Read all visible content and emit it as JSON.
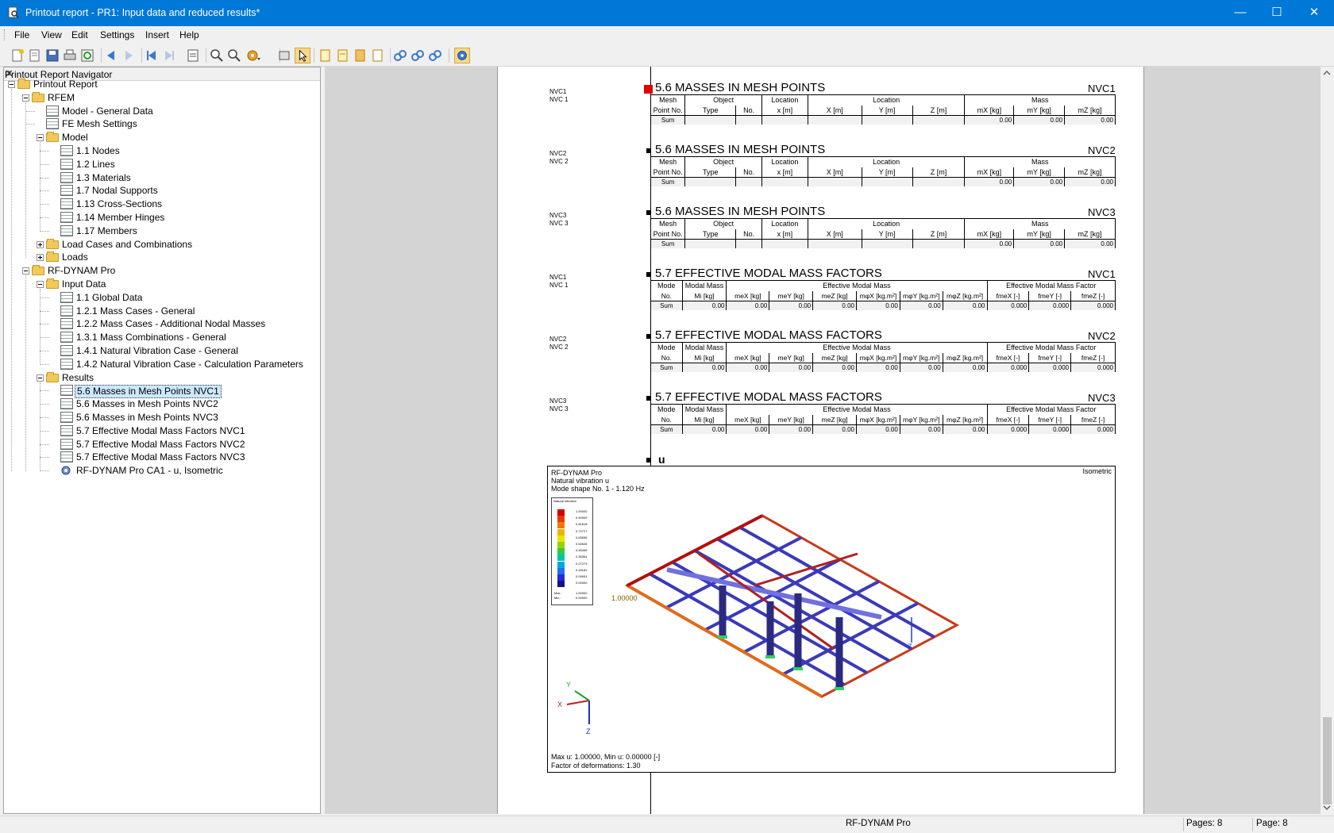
{
  "window": {
    "title": "Printout report - PR1: Input data and reduced results*",
    "minimize": "—",
    "maximize": "☐",
    "close": "✕"
  },
  "menu": [
    "File",
    "View",
    "Edit",
    "Settings",
    "Insert",
    "Help"
  ],
  "navigator": {
    "title": "Printout Report Navigator",
    "close": "✕",
    "items": [
      {
        "label": "Printout Report",
        "level": 0,
        "icon": "folder-icon",
        "exp": "minus"
      },
      {
        "label": "RFEM",
        "level": 1,
        "icon": "folder-icon",
        "exp": "minus"
      },
      {
        "label": "Model - General Data",
        "level": 2,
        "icon": "table-icon",
        "exp": ""
      },
      {
        "label": "FE Mesh Settings",
        "level": 2,
        "icon": "table-icon",
        "exp": ""
      },
      {
        "label": "Model",
        "level": 2,
        "icon": "folder-icon",
        "exp": "minus"
      },
      {
        "label": "1.1 Nodes",
        "level": 3,
        "icon": "table-icon",
        "exp": ""
      },
      {
        "label": "1.2 Lines",
        "level": 3,
        "icon": "table-icon",
        "exp": ""
      },
      {
        "label": "1.3 Materials",
        "level": 3,
        "icon": "table-icon",
        "exp": ""
      },
      {
        "label": "1.7 Nodal Supports",
        "level": 3,
        "icon": "table-icon",
        "exp": ""
      },
      {
        "label": "1.13 Cross-Sections",
        "level": 3,
        "icon": "table-icon",
        "exp": ""
      },
      {
        "label": "1.14 Member Hinges",
        "level": 3,
        "icon": "table-icon",
        "exp": ""
      },
      {
        "label": "1.17 Members",
        "level": 3,
        "icon": "table-icon",
        "exp": ""
      },
      {
        "label": "Load Cases and Combinations",
        "level": 2,
        "icon": "folder-icon",
        "exp": "plus"
      },
      {
        "label": "Loads",
        "level": 2,
        "icon": "folder-icon",
        "exp": "plus"
      },
      {
        "label": "RF-DYNAM Pro",
        "level": 1,
        "icon": "folder-icon",
        "exp": "minus"
      },
      {
        "label": "Input Data",
        "level": 2,
        "icon": "folder-icon",
        "exp": "minus"
      },
      {
        "label": "1.1 Global Data",
        "level": 3,
        "icon": "table-icon",
        "exp": ""
      },
      {
        "label": "1.2.1 Mass Cases - General",
        "level": 3,
        "icon": "table-icon",
        "exp": ""
      },
      {
        "label": "1.2.2 Mass Cases - Additional Nodal Masses",
        "level": 3,
        "icon": "table-icon",
        "exp": ""
      },
      {
        "label": "1.3.1 Mass Combinations - General",
        "level": 3,
        "icon": "table-icon",
        "exp": ""
      },
      {
        "label": "1.4.1 Natural Vibration Case - General",
        "level": 3,
        "icon": "table-icon",
        "exp": ""
      },
      {
        "label": "1.4.2 Natural Vibration Case - Calculation Parameters",
        "level": 3,
        "icon": "table-icon",
        "exp": ""
      },
      {
        "label": "Results",
        "level": 2,
        "icon": "folder-icon",
        "exp": "minus"
      },
      {
        "label": "5.6 Masses in Mesh Points NVC1",
        "level": 3,
        "icon": "table-icon",
        "exp": "",
        "selected": true
      },
      {
        "label": "5.6 Masses in Mesh Points NVC2",
        "level": 3,
        "icon": "table-icon",
        "exp": ""
      },
      {
        "label": "5.6 Masses in Mesh Points NVC3",
        "level": 3,
        "icon": "table-icon",
        "exp": ""
      },
      {
        "label": "5.7 Effective Modal Mass Factors NVC1",
        "level": 3,
        "icon": "table-icon",
        "exp": ""
      },
      {
        "label": "5.7 Effective Modal Mass Factors NVC2",
        "level": 3,
        "icon": "table-icon",
        "exp": ""
      },
      {
        "label": "5.7 Effective Modal Mass Factors NVC3",
        "level": 3,
        "icon": "table-icon",
        "exp": ""
      },
      {
        "label": "RF-DYNAM Pro CA1 -  u, Isometric",
        "level": 3,
        "icon": "graphic-icon",
        "exp": ""
      }
    ]
  },
  "report": {
    "masses": [
      {
        "side1": "NVC1",
        "side2": "NVC 1",
        "title": "5.6 MASSES IN MESH POINTS",
        "nvc": "NVC1",
        "sum": [
          "0.00",
          "0.00",
          "0.00"
        ]
      },
      {
        "side1": "NVC2",
        "side2": "NVC 2",
        "title": "5.6 MASSES IN MESH POINTS",
        "nvc": "NVC2",
        "sum": [
          "0.00",
          "0.00",
          "0.00"
        ]
      },
      {
        "side1": "NVC3",
        "side2": "NVC 3",
        "title": "5.6 MASSES IN MESH POINTS",
        "nvc": "NVC3",
        "sum": [
          "0.00",
          "0.00",
          "0.00"
        ]
      }
    ],
    "masses_header": {
      "r1": [
        "Mesh",
        "Object",
        "",
        "Location",
        "Location",
        "",
        "",
        "Mass",
        "",
        ""
      ],
      "r2": [
        "Point No.",
        "Type",
        "No.",
        "x [m]",
        "X [m]",
        "Y [m]",
        "Z [m]",
        "mX [kg]",
        "mY [kg]",
        "mZ [kg]"
      ],
      "sum_label": "Sum"
    },
    "factors": [
      {
        "side1": "NVC1",
        "side2": "NVC 1",
        "title": "5.7 EFFECTIVE MODAL MASS FACTORS",
        "nvc": "NVC1"
      },
      {
        "side1": "NVC2",
        "side2": "NVC 2",
        "title": "5.7 EFFECTIVE MODAL MASS FACTORS",
        "nvc": "NVC2"
      },
      {
        "side1": "NVC3",
        "side2": "NVC 3",
        "title": "5.7 EFFECTIVE MODAL MASS FACTORS",
        "nvc": "NVC3"
      }
    ],
    "factors_header": {
      "r1": [
        "Mode",
        "Modal Mass",
        "Effective Modal Mass",
        "Effective Modal Mass Factor"
      ],
      "r2": [
        "No.",
        "Mi [kg]",
        "meX [kg]",
        "meY [kg]",
        "meZ [kg]",
        "mφX [kg.m²]",
        "mφY [kg.m²]",
        "mφZ [kg.m²]",
        "fmeX [-]",
        "fmeY [-]",
        "fmeZ [-]"
      ],
      "sum": [
        "Sum",
        "0.00",
        "0.00",
        "0.00",
        "0.00",
        "0.00",
        "0.00",
        "0.00",
        "0.000",
        "0.000",
        "0.000"
      ]
    },
    "graphic_heading": "u",
    "graphic": {
      "line1": "RF-DYNAM Pro",
      "line2": "Natural vibration u",
      "line3": "Mode shape No. 1 - 1.120 Hz",
      "view": "Isometric",
      "max_min": "Max u: 1.00000, Min u: 0.00000 [-]",
      "factor": "Factor of deformations: 1.30",
      "value_label": "1.00000",
      "legend_title": "Natural vibration",
      "legend_values": [
        "1.00000",
        "0.90909",
        "0.81818",
        "0.72727",
        "0.63636",
        "0.54545",
        "0.45455",
        "0.36364",
        "0.27273",
        "0.18182",
        "0.09091",
        "0.00000"
      ],
      "legend_colors": [
        "#d40000",
        "#e83a00",
        "#f07a00",
        "#f0b400",
        "#e6e600",
        "#9ad200",
        "#2ecc40",
        "#00c8a0",
        "#00a8e0",
        "#2070f0",
        "#2a2ad8",
        "#101090"
      ],
      "legend_max": "1.00000",
      "legend_min": "0.00000",
      "legend_max_label": "Max :",
      "legend_min_label": "Min :",
      "axis_x": "X",
      "axis_y": "Y",
      "axis_z": "Z",
      "axis_z2": "Z"
    }
  },
  "status": {
    "module": "RF-DYNAM Pro",
    "pages": "Pages: 8",
    "page": "Page: 8"
  }
}
